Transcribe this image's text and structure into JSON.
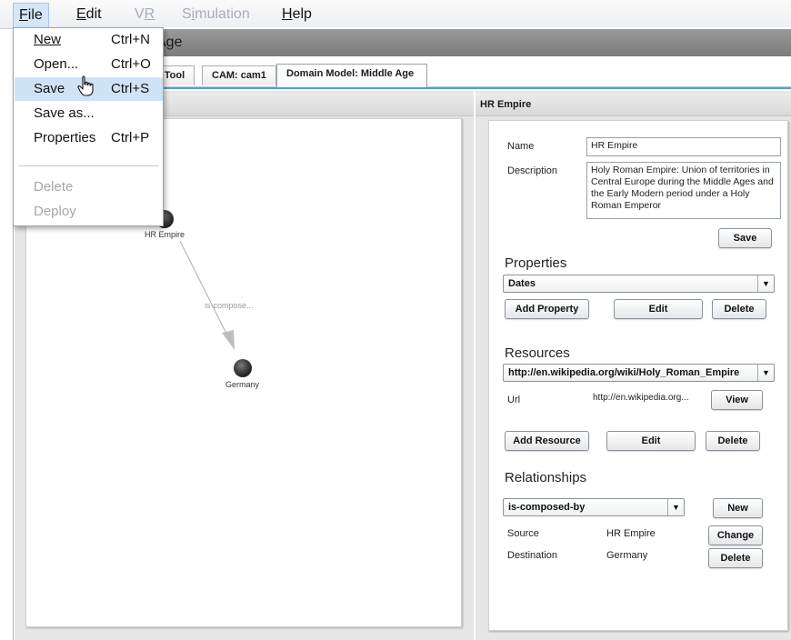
{
  "menubar": {
    "items": [
      {
        "label": "File",
        "mnemonic": "F",
        "rest": "ile",
        "state": "active"
      },
      {
        "label": "Edit",
        "mnemonic": "E",
        "rest": "dit",
        "state": "normal"
      },
      {
        "label": "VR",
        "pre": "V",
        "mnemonic": "R",
        "state": "disabled"
      },
      {
        "label": "Simulation",
        "pre": "S",
        "mnemonic": "i",
        "rest": "mulation",
        "state": "disabled"
      },
      {
        "label": "Help",
        "mnemonic": "H",
        "rest": "elp",
        "state": "normal"
      }
    ]
  },
  "file_menu": {
    "items": [
      {
        "label": "New",
        "accel": "Ctrl+N",
        "state": "normal"
      },
      {
        "label": "Open...",
        "accel": "Ctrl+O",
        "state": "normal"
      },
      {
        "label": "Save",
        "accel": "Ctrl+S",
        "state": "highlighted"
      },
      {
        "label": "Save as...",
        "accel": "",
        "state": "normal"
      },
      {
        "label": "Properties",
        "accel": "Ctrl+P",
        "state": "normal"
      },
      {
        "label": "Delete",
        "accel": "",
        "state": "disabled"
      },
      {
        "label": "Deploy",
        "accel": "",
        "state": "disabled"
      }
    ]
  },
  "window": {
    "title_visible_fragment": "Age"
  },
  "tabs": [
    {
      "label": "T Tool",
      "selected": false
    },
    {
      "label": "CAM: cam1",
      "selected": false
    },
    {
      "label": "Domain Model: Middle Age",
      "selected": true
    }
  ],
  "graph": {
    "nodes": [
      {
        "label": "HR Empire"
      },
      {
        "label": "Germany"
      }
    ],
    "edge_label": "is-compose..."
  },
  "detail": {
    "title": "HR Empire",
    "name_label": "Name",
    "name_value": "HR Empire",
    "description_label": "Description",
    "description_value": "Holy Roman Empire: Union of territories in Central Europe during the Middle Ages and the Early Modern period under a Holy Roman Emperor",
    "save_button": "Save",
    "properties": {
      "title": "Properties",
      "selected": "Dates",
      "add_button": "Add Property",
      "edit_button": "Edit",
      "delete_button": "Delete"
    },
    "resources": {
      "title": "Resources",
      "selected": "http://en.wikipedia.org/wiki/Holy_Roman_Empire",
      "url_label": "Url",
      "url_value": "http://en.wikipedia.org...",
      "view_button": "View",
      "add_button": "Add Resource",
      "edit_button": "Edit",
      "delete_button": "Delete"
    },
    "relationships": {
      "title": "Relationships",
      "selected": "is-composed-by",
      "new_button": "New",
      "source_label": "Source",
      "source_value": "HR Empire",
      "change_button": "Change",
      "destination_label": "Destination",
      "destination_value": "Germany",
      "delete_button": "Delete"
    }
  },
  "colors": {
    "accent": "#4aa3de",
    "menu_highlight": "#cfe3f7",
    "title_bar": "#8a8a8a"
  }
}
